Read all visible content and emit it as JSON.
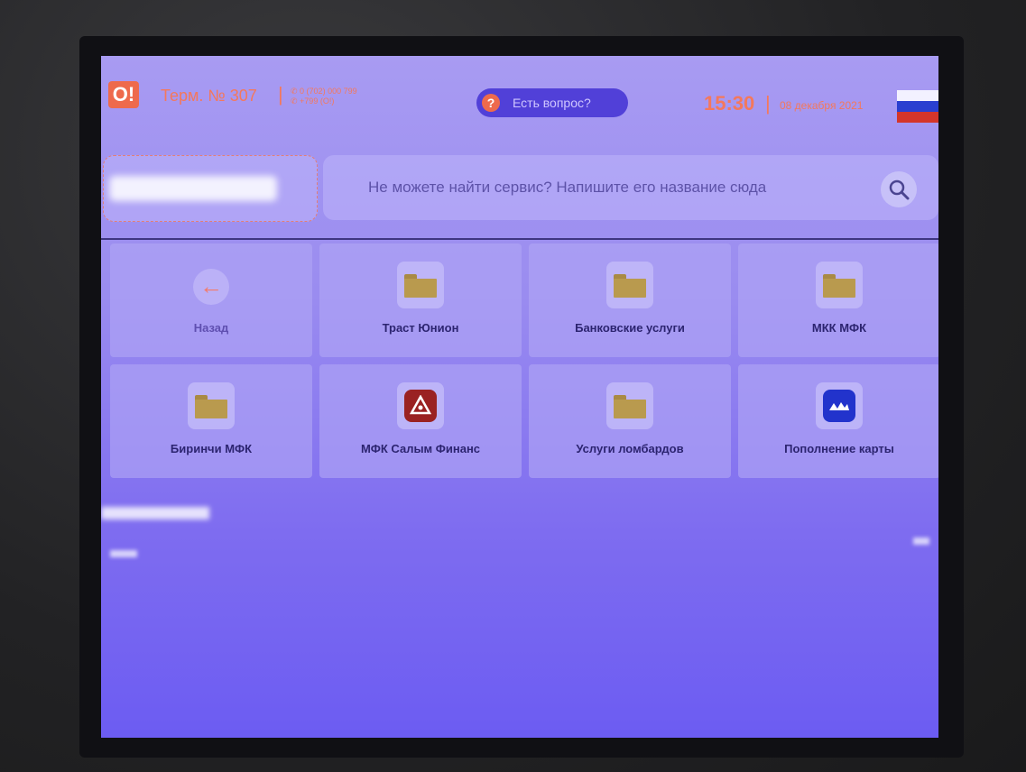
{
  "header": {
    "logo_text": "O!",
    "terminal": "Терм. № 307",
    "separator": "|",
    "phone_1": "0 (702) 000 799",
    "phone_2": "+799 (O!)",
    "help_label": "Есть вопрос?",
    "time": "15:30",
    "date": "08 декабря 2021",
    "flag_colors": [
      "#ffffff",
      "#1a3ccf",
      "#d9271f"
    ]
  },
  "search": {
    "placeholder": "Не можете найти сервис? Напишите его название сюда",
    "icon": "search-icon"
  },
  "tiles": [
    {
      "label": "Назад",
      "icon": "arrow-left-icon"
    },
    {
      "label": "Траст Юнион",
      "icon": "folder-icon"
    },
    {
      "label": "Банковские услуги",
      "icon": "folder-icon"
    },
    {
      "label": "МКК МФК",
      "icon": "folder-icon"
    },
    {
      "label": "Биринчи МФК",
      "icon": "folder-icon"
    },
    {
      "label": "МФК Салым Финанс",
      "icon": "salym-logo-icon"
    },
    {
      "label": "Услуги ломбардов",
      "icon": "folder-icon"
    },
    {
      "label": "Пополнение карты",
      "icon": "card-topup-icon"
    }
  ]
}
